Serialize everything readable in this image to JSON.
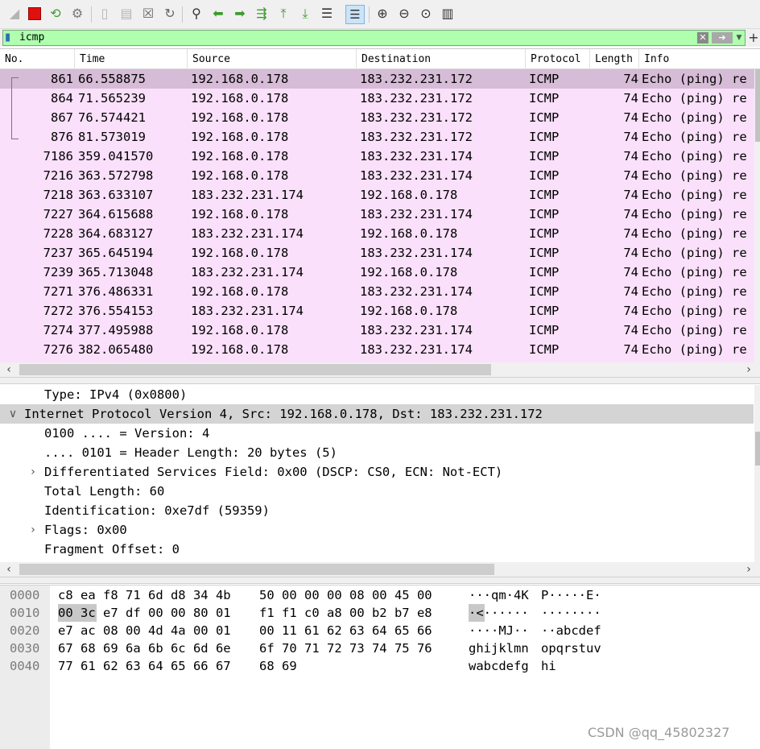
{
  "filter": {
    "value": "icmp"
  },
  "columns": [
    "No.",
    "Time",
    "Source",
    "Destination",
    "Protocol",
    "Length",
    "Info"
  ],
  "packets": [
    {
      "no": "861",
      "time": "66.558875",
      "src": "192.168.0.178",
      "dst": "183.232.231.172",
      "proto": "ICMP",
      "len": "74",
      "info": "Echo (ping) re"
    },
    {
      "no": "864",
      "time": "71.565239",
      "src": "192.168.0.178",
      "dst": "183.232.231.172",
      "proto": "ICMP",
      "len": "74",
      "info": "Echo (ping) re"
    },
    {
      "no": "867",
      "time": "76.574421",
      "src": "192.168.0.178",
      "dst": "183.232.231.172",
      "proto": "ICMP",
      "len": "74",
      "info": "Echo (ping) re"
    },
    {
      "no": "876",
      "time": "81.573019",
      "src": "192.168.0.178",
      "dst": "183.232.231.172",
      "proto": "ICMP",
      "len": "74",
      "info": "Echo (ping) re"
    },
    {
      "no": "7186",
      "time": "359.041570",
      "src": "192.168.0.178",
      "dst": "183.232.231.174",
      "proto": "ICMP",
      "len": "74",
      "info": "Echo (ping) re"
    },
    {
      "no": "7216",
      "time": "363.572798",
      "src": "192.168.0.178",
      "dst": "183.232.231.174",
      "proto": "ICMP",
      "len": "74",
      "info": "Echo (ping) re"
    },
    {
      "no": "7218",
      "time": "363.633107",
      "src": "183.232.231.174",
      "dst": "192.168.0.178",
      "proto": "ICMP",
      "len": "74",
      "info": "Echo (ping) re"
    },
    {
      "no": "7227",
      "time": "364.615688",
      "src": "192.168.0.178",
      "dst": "183.232.231.174",
      "proto": "ICMP",
      "len": "74",
      "info": "Echo (ping) re"
    },
    {
      "no": "7228",
      "time": "364.683127",
      "src": "183.232.231.174",
      "dst": "192.168.0.178",
      "proto": "ICMP",
      "len": "74",
      "info": "Echo (ping) re"
    },
    {
      "no": "7237",
      "time": "365.645194",
      "src": "192.168.0.178",
      "dst": "183.232.231.174",
      "proto": "ICMP",
      "len": "74",
      "info": "Echo (ping) re"
    },
    {
      "no": "7239",
      "time": "365.713048",
      "src": "183.232.231.174",
      "dst": "192.168.0.178",
      "proto": "ICMP",
      "len": "74",
      "info": "Echo (ping) re"
    },
    {
      "no": "7271",
      "time": "376.486331",
      "src": "192.168.0.178",
      "dst": "183.232.231.174",
      "proto": "ICMP",
      "len": "74",
      "info": "Echo (ping) re"
    },
    {
      "no": "7272",
      "time": "376.554153",
      "src": "183.232.231.174",
      "dst": "192.168.0.178",
      "proto": "ICMP",
      "len": "74",
      "info": "Echo (ping) re"
    },
    {
      "no": "7274",
      "time": "377.495988",
      "src": "192.168.0.178",
      "dst": "183.232.231.174",
      "proto": "ICMP",
      "len": "74",
      "info": "Echo (ping) re"
    },
    {
      "no": "7276",
      "time": "382.065480",
      "src": "192.168.0.178",
      "dst": "183.232.231.174",
      "proto": "ICMP",
      "len": "74",
      "info": "Echo (ping) re"
    }
  ],
  "details": [
    {
      "text": "Type: IPv4 (0x0800)",
      "expander": "",
      "indent": 1
    },
    {
      "text": "Internet Protocol Version 4, Src: 192.168.0.178, Dst: 183.232.231.172",
      "expander": "∨",
      "indent": 0
    },
    {
      "text": "0100 .... = Version: 4",
      "expander": "",
      "indent": 1
    },
    {
      "text": ".... 0101 = Header Length: 20 bytes (5)",
      "expander": "",
      "indent": 1
    },
    {
      "text": "Differentiated Services Field: 0x00 (DSCP: CS0, ECN: Not-ECT)",
      "expander": "›",
      "indent": 1
    },
    {
      "text": "Total Length: 60",
      "expander": "",
      "indent": 1
    },
    {
      "text": "Identification: 0xe7df (59359)",
      "expander": "",
      "indent": 1
    },
    {
      "text": "Flags: 0x00",
      "expander": "›",
      "indent": 1
    },
    {
      "text": "Fragment Offset: 0",
      "expander": "",
      "indent": 1
    }
  ],
  "bytes": [
    {
      "offset": "0000",
      "hex1": "c8 ea f8 71 6d d8 34 4b",
      "hex2": "50 00 00 00 08 00 45 00",
      "ascii1": "···qm·4K",
      "ascii2": "P·····E·"
    },
    {
      "offset": "0010",
      "hex1": "00 3c e7 df 00 00 80 01",
      "hex2": "f1 f1 c0 a8 00 b2 b7 e8",
      "ascii1": "·<······",
      "ascii2": "········"
    },
    {
      "offset": "0020",
      "hex1": "e7 ac 08 00 4d 4a 00 01",
      "hex2": "00 11 61 62 63 64 65 66",
      "ascii1": "····MJ··",
      "ascii2": "··abcdef"
    },
    {
      "offset": "0030",
      "hex1": "67 68 69 6a 6b 6c 6d 6e",
      "hex2": "6f 70 71 72 73 74 75 76",
      "ascii1": "ghijklmn",
      "ascii2": "opqrstuv"
    },
    {
      "offset": "0040",
      "hex1": "77 61 62 63 64 65 66 67",
      "hex2": "68 69",
      "ascii1": "wabcdefg",
      "ascii2": "hi"
    }
  ],
  "toolbar_icons": [
    "shark-fin-icon",
    "stop-capture-icon",
    "restart-capture-icon",
    "capture-options-icon",
    "open-file-icon",
    "save-file-icon",
    "close-file-icon",
    "reload-file-icon",
    "find-packet-icon",
    "go-back-icon",
    "go-forward-icon",
    "go-to-packet-icon",
    "first-packet-icon",
    "last-packet-icon",
    "auto-scroll-icon",
    "colorize-icon",
    "zoom-in-icon",
    "zoom-out-icon",
    "normal-size-icon",
    "resize-columns-icon"
  ],
  "watermark": "CSDN @qq_45802327",
  "colors": {
    "row_bg": "#fae0fa",
    "row_selected": "#d6bcd6",
    "filter_bg": "#afffaf",
    "detail_highlight": "#d4d4d4"
  }
}
